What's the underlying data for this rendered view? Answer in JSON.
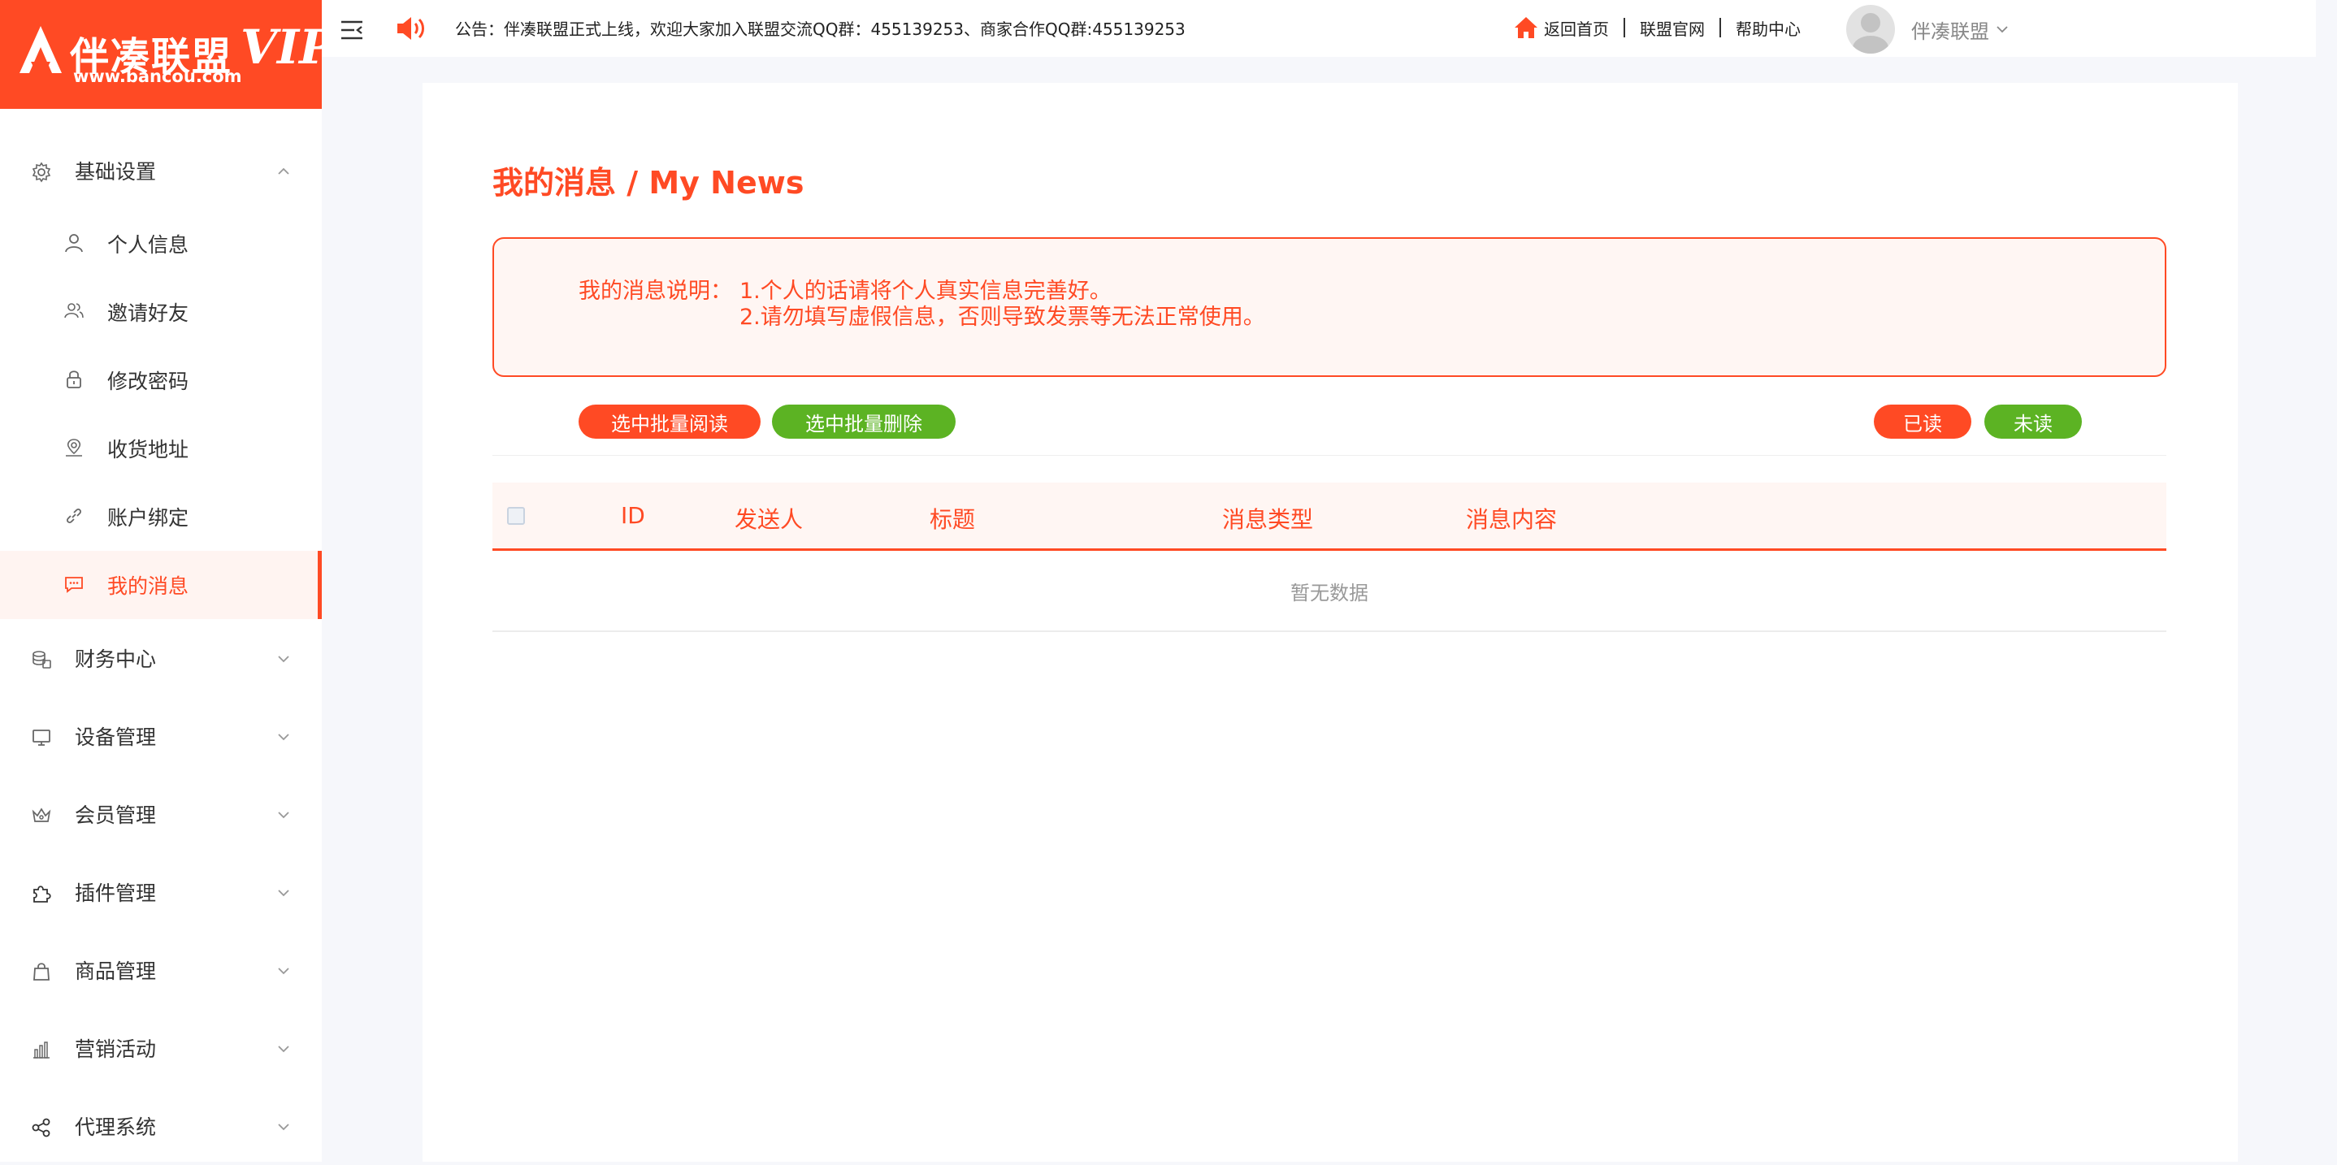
{
  "logo": {
    "brand": "伴凑联盟",
    "url": "www.bancou.com",
    "vip": "VIP"
  },
  "sidebar": {
    "groups": [
      {
        "label": "基础设置",
        "icon": "gear-icon",
        "expanded": true,
        "items": [
          {
            "label": "个人信息",
            "icon": "user-icon"
          },
          {
            "label": "邀请好友",
            "icon": "users-icon"
          },
          {
            "label": "修改密码",
            "icon": "lock-icon"
          },
          {
            "label": "收货地址",
            "icon": "location-icon"
          },
          {
            "label": "账户绑定",
            "icon": "link-icon"
          },
          {
            "label": "我的消息",
            "icon": "message-icon",
            "active": true
          }
        ]
      },
      {
        "label": "财务中心",
        "icon": "coins-icon"
      },
      {
        "label": "设备管理",
        "icon": "monitor-icon"
      },
      {
        "label": "会员管理",
        "icon": "crown-icon"
      },
      {
        "label": "插件管理",
        "icon": "puzzle-icon"
      },
      {
        "label": "商品管理",
        "icon": "bag-icon"
      },
      {
        "label": "营销活动",
        "icon": "bar-chart-icon"
      },
      {
        "label": "代理系统",
        "icon": "share-icon"
      }
    ]
  },
  "topbar": {
    "notice": "公告：伴凑联盟正式上线，欢迎大家加入联盟交流QQ群：455139253、商家合作QQ群:455139253",
    "links": {
      "home": "返回首页",
      "official": "联盟官网",
      "help": "帮助中心"
    },
    "user": "伴凑联盟"
  },
  "main": {
    "title": "我的消息 / My News",
    "notice_box": {
      "lead": "我的消息说明：",
      "line1": "1.个人的话请将个人真实信息完善好。",
      "line2": "2.请勿填写虚假信息，否则导致发票等无法正常使用。"
    },
    "buttons": {
      "batch_read": "选中批量阅读",
      "batch_delete": "选中批量删除",
      "read": "已读",
      "unread": "未读"
    },
    "table": {
      "columns": [
        "ID",
        "发送人",
        "标题",
        "消息类型",
        "消息内容"
      ],
      "empty": "暂无数据"
    }
  },
  "colors": {
    "accent": "#ff4a24",
    "green": "#5cb323",
    "tint": "#fff6f3"
  }
}
